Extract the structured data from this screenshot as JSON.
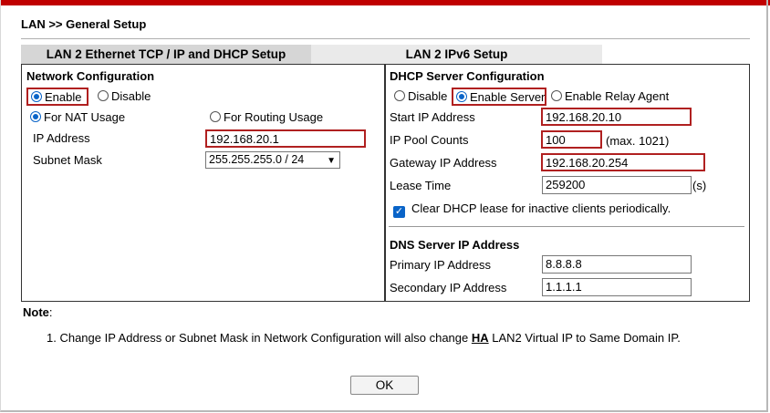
{
  "page": {
    "title": "LAN >> General Setup"
  },
  "tabs": [
    {
      "label": "LAN 2 Ethernet TCP / IP and DHCP Setup",
      "active": true
    },
    {
      "label": "LAN 2 IPv6 Setup",
      "active": false
    }
  ],
  "network": {
    "heading": "Network Configuration",
    "enable_label": "Enable",
    "disable_label": "Disable",
    "nat_label": "For NAT Usage",
    "routing_label": "For Routing Usage",
    "ip_label": "IP Address",
    "ip_value": "192.168.20.1",
    "mask_label": "Subnet Mask",
    "mask_value": "255.255.255.0 / 24"
  },
  "dhcp": {
    "heading": "DHCP Server Configuration",
    "disable_label": "Disable",
    "enable_server_label": "Enable Server",
    "relay_label": "Enable Relay Agent",
    "start_ip_label": "Start IP Address",
    "start_ip_value": "192.168.20.10",
    "pool_label": "IP Pool Counts",
    "pool_value": "100",
    "pool_max": "(max. 1021)",
    "gateway_label": "Gateway IP Address",
    "gateway_value": "192.168.20.254",
    "lease_label": "Lease Time",
    "lease_value": "259200",
    "lease_unit": "(s)",
    "clear_label": "Clear DHCP lease for inactive clients periodically."
  },
  "dns": {
    "heading": "DNS Server IP Address",
    "primary_label": "Primary IP Address",
    "primary_value": "8.8.8.8",
    "secondary_label": "Secondary IP Address",
    "secondary_value": "1.1.1.1"
  },
  "note": {
    "heading": "Note",
    "colon": ":",
    "line_prefix": "1. Change IP Address or Subnet Mask in Network Configuration will also change ",
    "line_ha": "HA",
    "line_suffix": " LAN2 Virtual IP to Same Domain IP."
  },
  "ok_label": "OK",
  "colors": {
    "accent_red": "#c00000",
    "radio_blue": "#0a64c8",
    "highlight_border": "#b02020"
  }
}
